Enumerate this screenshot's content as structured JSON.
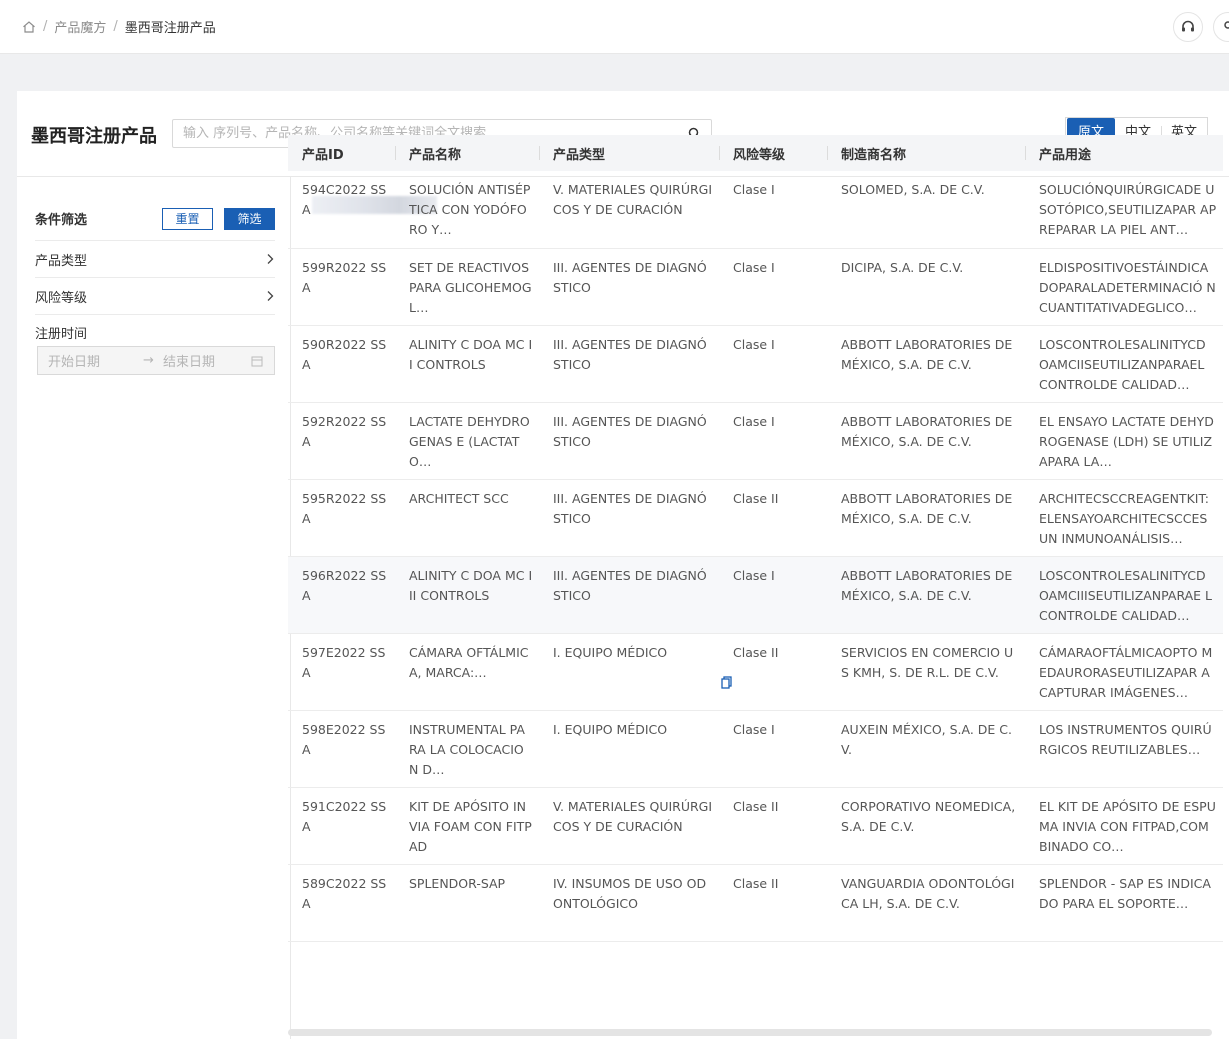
{
  "breadcrumb": {
    "items": [
      "产品魔方",
      "墨西哥注册产品"
    ]
  },
  "page": {
    "title": "墨西哥注册产品"
  },
  "search": {
    "placeholder": "输入 序列号、产品名称、公司名称等关键词全文搜索"
  },
  "lang": {
    "options": [
      "原文",
      "中文",
      "英文"
    ],
    "active": "原文"
  },
  "filters": {
    "title": "条件筛选",
    "reset_label": "重置",
    "apply_label": "筛选",
    "product_type_label": "产品类型",
    "risk_level_label": "风险等级",
    "reg_time_label": "注册时间",
    "start_placeholder": "开始日期",
    "end_placeholder": "结束日期"
  },
  "table": {
    "columns": [
      "产品ID",
      "产品名称",
      "产品类型",
      "风险等级",
      "制造商名称",
      "产品用途"
    ],
    "rows": [
      {
        "id": "594C2022 SSA",
        "name": "SOLUCIÓN ANTISÉPTICA CON YODÓFORO Y…",
        "type": "V. MATERIALES QUIRÚRGICOS Y DE CURACIÓN",
        "risk": "Clase I",
        "maker": "SOLOMED, S.A. DE C.V.",
        "use": "SOLUCIÓNQUIRÚRGICADE USOTÓPICO,SEUTILIZAPAR APREPARAR LA PIEL ANT…"
      },
      {
        "id": "599R2022 SSA",
        "name": "SET DE REACTIVOS PARA GLICOHEMOGL…",
        "type": "III. AGENTES DE DIAGNÓSTICO",
        "risk": "Clase I",
        "maker": "DICIPA, S.A. DE C.V.",
        "use": "ELDISPOSITIVOESTÁINDICA DOPARALADETERMINACIÓ NCUANTITATIVADEGLICO…"
      },
      {
        "id": "590R2022 SSA",
        "name": "ALINITY C DOA MC II CONTROLS",
        "type": "III. AGENTES DE DIAGNÓSTICO",
        "risk": "Clase I",
        "maker": "ABBOTT LABORATORIES DE MÉXICO, S.A. DE C.V.",
        "use": "LOSCONTROLESALINITYCD OAMCIISEUTILIZANPARAEL CONTROLDE CALIDAD…"
      },
      {
        "id": "592R2022 SSA",
        "name": "LACTATE DEHYDROGENAS E (LACTATO…",
        "type": "III. AGENTES DE DIAGNÓSTICO",
        "risk": "Clase I",
        "maker": "ABBOTT LABORATORIES DE MÉXICO, S.A. DE C.V.",
        "use": "EL ENSAYO LACTATE DEHYDROGENASE (LDH) SE UTILIZAPARA LA…"
      },
      {
        "id": "595R2022 SSA",
        "name": "ARCHITECT SCC",
        "type": "III. AGENTES DE DIAGNÓSTICO",
        "risk": "Clase II",
        "maker": "ABBOTT LABORATORIES DE MÉXICO, S.A. DE C.V.",
        "use": "ARCHITECSCCREAGENTKIT: ELENSAYOARCHITECSCCES UN INMUNOANÁLISIS…"
      },
      {
        "id": "596R2022 SSA",
        "name": "ALINITY C DOA MC III CONTROLS",
        "type": "III. AGENTES DE DIAGNÓSTICO",
        "risk": "Clase I",
        "maker": "ABBOTT LABORATORIES DE MÉXICO, S.A. DE C.V.",
        "use": "LOSCONTROLESALINITYCD OAMCIIISEUTILIZANPARAE LCONTROLDE CALIDAD…"
      },
      {
        "id": "597E2022 SSA",
        "name": "CÁMARA OFTÁLMICA, MARCA:…",
        "type": "I. EQUIPO MÉDICO",
        "risk": "Clase II",
        "maker": "SERVICIOS EN COMERCIO US KMH, S. DE R.L. DE C.V.",
        "use": "CÁMARAOFTÁLMICAOPTO MEDAURORASEUTILIZAPAR ACAPTURAR IMÁGENES…"
      },
      {
        "id": "598E2022 SSA",
        "name": "INSTRUMENTAL PARA LA COLOCACION D…",
        "type": "I. EQUIPO MÉDICO",
        "risk": "Clase I",
        "maker": "AUXEIN MÉXICO, S.A. DE C.V.",
        "use": "LOS INSTRUMENTOS QUIRÚRGICOS REUTILIZABLES…"
      },
      {
        "id": "591C2022 SSA",
        "name": "KIT DE APÓSITO INVIA FOAM CON FITPAD",
        "type": "V. MATERIALES QUIRÚRGICOS Y DE CURACIÓN",
        "risk": "Clase II",
        "maker": "CORPORATIVO NEOMEDICA, S.A. DE C.V.",
        "use": "EL KIT DE APÓSITO DE ESPUMA INVIA CON FITPAD,COMBINADO CO…"
      },
      {
        "id": "589C2022 SSA",
        "name": "SPLENDOR-SAP",
        "type": "IV. INSUMOS DE USO ODONTOLÓGICO",
        "risk": "Clase II",
        "maker": "VANGUARDIA ODONTOLÓGICA LH, S.A. DE C.V.",
        "use": "SPLENDOR - SAP ES INDICADO PARA EL SOPORTE…"
      }
    ]
  }
}
